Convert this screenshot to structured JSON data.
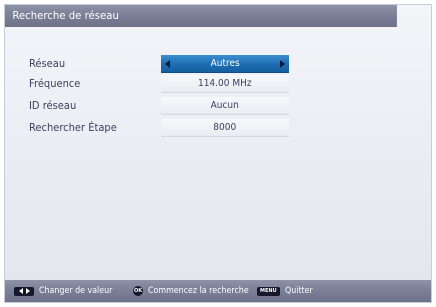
{
  "window": {
    "title": "Recherche de réseau"
  },
  "settings": [
    {
      "label": "Réseau",
      "value": "Autres",
      "selected": true
    },
    {
      "label": "Fréquence",
      "value": "114.00 MHz",
      "selected": false
    },
    {
      "label": "ID réseau",
      "value": "Aucun",
      "selected": false
    },
    {
      "label": "Rechercher Étape",
      "value": "8000",
      "selected": false
    }
  ],
  "footer": {
    "change_value": {
      "key": "left-right-arrows-icon",
      "text": "Changer de valeur"
    },
    "start_search": {
      "key_label": "OK",
      "text": "Commencez la recherche"
    },
    "quit": {
      "key_label": "MENU",
      "text": "Quitter"
    }
  },
  "colors": {
    "selected": "#1f6fb4",
    "bar": "#7a7e96",
    "text": "#3a3f5c"
  }
}
